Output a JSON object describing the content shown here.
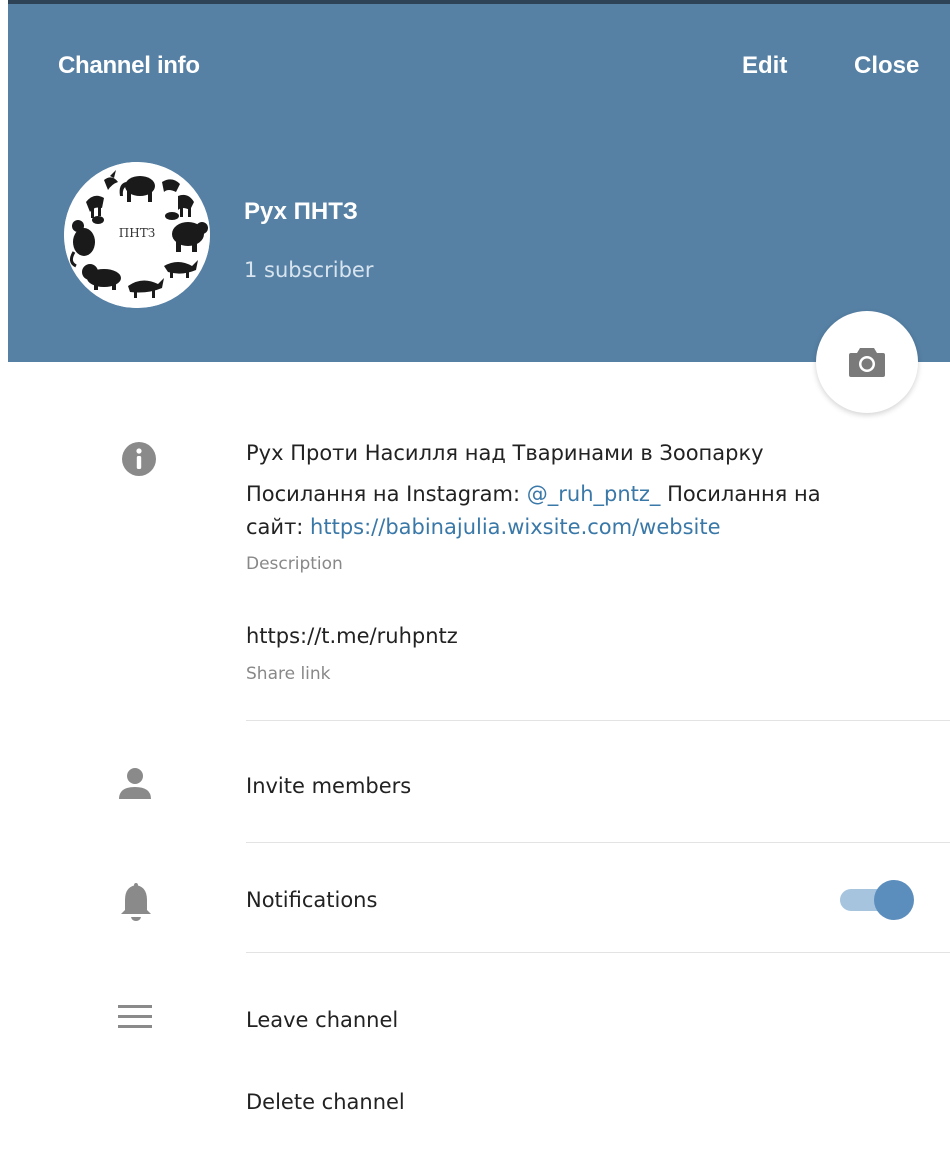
{
  "header": {
    "title": "Channel info",
    "edit_label": "Edit",
    "close_label": "Close",
    "bg_color": "#5681a5"
  },
  "channel": {
    "name": "Рух ПНТЗ",
    "subscribers": "1 subscriber",
    "avatar_text": "ПНТЗ"
  },
  "camera_button": {
    "icon": "camera-icon"
  },
  "info": {
    "icon": "info-icon",
    "description_line1": "Рух Проти Насилля над Тваринами в Зоопарку",
    "description_line2_prefix": "Посилання на Instagram: ",
    "instagram_handle": "@_ruh_pntz_",
    "description_line2_suffix": " Посилання на",
    "description_line3_prefix": "сайт: ",
    "website_url": "https://babinajulia.wixsite.com/website",
    "description_caption": "Description",
    "share_link": "https://t.me/ruhpntz",
    "share_link_caption": "Share link"
  },
  "actions": {
    "invite": {
      "label": "Invite members",
      "icon": "person-icon"
    },
    "notifications": {
      "label": "Notifications",
      "icon": "bell-icon",
      "enabled": true
    },
    "leave": {
      "label": "Leave channel",
      "icon": "menu-icon"
    },
    "delete": {
      "label": "Delete channel"
    }
  },
  "colors": {
    "accent": "#5681a5",
    "link": "#3a78a8",
    "toggle_on": "#5b8dbd",
    "icon_gray": "#8a8a8a"
  }
}
